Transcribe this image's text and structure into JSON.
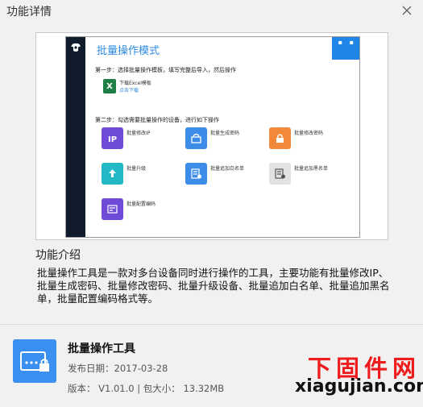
{
  "window": {
    "title": "功能详情"
  },
  "preview": {
    "title": "批量操作模式",
    "step1": "第一步：选择批量操作模板，填写完整后导入，然后操作",
    "excel_label": "下载Excel模板",
    "excel_link": "点击下载",
    "step2": "第二步：勾选需要批量操作的设备，进行如下操作",
    "tiles": [
      {
        "label": "批量修改IP",
        "icon": "ip-icon",
        "color": "#6f4bd8"
      },
      {
        "label": "批量生成密码",
        "icon": "lock-icon",
        "color": "#3d8de8"
      },
      {
        "label": "批量修改密码",
        "icon": "padlock-icon",
        "color": "#f2893a"
      },
      {
        "label": "批量升级",
        "icon": "upload-icon",
        "color": "#22b8c6"
      },
      {
        "label": "批量追加白名单",
        "icon": "whitelist-icon",
        "color": "#3d8de8"
      },
      {
        "label": "批量追加黑名单",
        "icon": "blacklist-icon",
        "color": "#7d7d7d"
      },
      {
        "label": "批量配置编码",
        "icon": "config-icon",
        "color": "#6f4bd8"
      }
    ]
  },
  "intro": {
    "heading": "功能介绍",
    "text": "批量操作工具是一款对多台设备同时进行操作的工具，主要功能有批量修改IP、批量生成密码、批量修改密码、批量升级设备、批量追加白名单、批量追加黑名单，批量配置编码格式等。"
  },
  "tool": {
    "name": "批量操作工具",
    "date": "发布日期：2017-03-28",
    "meta": "版本： V1.01.0 | 包大小： 13.32MB"
  },
  "watermark": {
    "cn": "下固件网",
    "en": "xiagujian.com"
  }
}
